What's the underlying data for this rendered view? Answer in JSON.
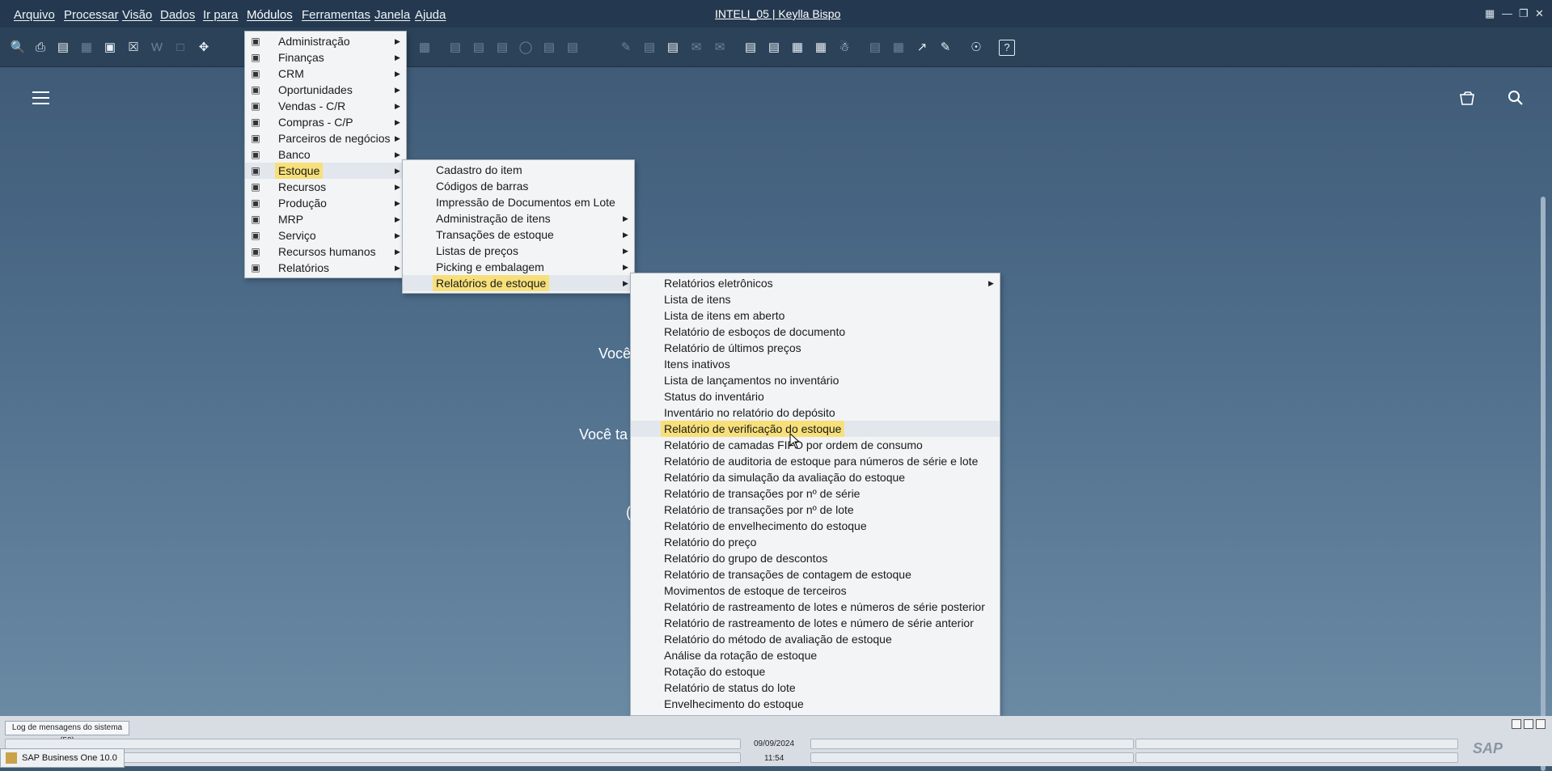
{
  "window": {
    "title": "INTELI_05 | Keylla Bispo"
  },
  "menubar": [
    {
      "label": "Arquivo"
    },
    {
      "label": "Processar"
    },
    {
      "label": "Visão"
    },
    {
      "label": "Dados"
    },
    {
      "label": "Ir para"
    },
    {
      "label": "Módulos"
    },
    {
      "label": "Ferramentas"
    },
    {
      "label": "Janela"
    },
    {
      "label": "Ajuda"
    }
  ],
  "modules_menu": [
    {
      "label": "Administração",
      "icon": "gear-icon"
    },
    {
      "label": "Finanças",
      "icon": "ledger-icon"
    },
    {
      "label": "CRM",
      "icon": "people-icon"
    },
    {
      "label": "Oportunidades",
      "icon": "chart-icon"
    },
    {
      "label": "Vendas - C/R",
      "icon": "dollar-icon"
    },
    {
      "label": "Compras - C/P",
      "icon": "cart-icon"
    },
    {
      "label": "Parceiros de negócios",
      "icon": "contacts-icon"
    },
    {
      "label": "Banco",
      "icon": "moneybag-icon"
    },
    {
      "label": "Estoque",
      "icon": "truck-icon"
    },
    {
      "label": "Recursos",
      "icon": "cube-icon"
    },
    {
      "label": "Produção",
      "icon": "box-icon"
    },
    {
      "label": "MRP",
      "icon": "calendar-icon"
    },
    {
      "label": "Serviço",
      "icon": "bank-icon"
    },
    {
      "label": "Recursos humanos",
      "icon": "person-icon"
    },
    {
      "label": "Relatórios",
      "icon": "report-icon"
    }
  ],
  "stock_menu": [
    {
      "label": "Cadastro do item"
    },
    {
      "label": "Códigos de barras"
    },
    {
      "label": "Impressão de Documentos em Lote"
    },
    {
      "label": "Administração de itens"
    },
    {
      "label": "Transações de estoque"
    },
    {
      "label": "Listas de preços"
    },
    {
      "label": "Picking e embalagem"
    },
    {
      "label": "Relatórios de estoque"
    }
  ],
  "stock_reports_menu": [
    {
      "label": "Relatórios eletrônicos"
    },
    {
      "label": "Lista de itens"
    },
    {
      "label": "Lista de itens em aberto"
    },
    {
      "label": "Relatório de esboços de documento"
    },
    {
      "label": "Relatório de últimos preços"
    },
    {
      "label": "Itens inativos"
    },
    {
      "label": "Lista de lançamentos no inventário"
    },
    {
      "label": "Status do inventário"
    },
    {
      "label": "Inventário no relatório do depósito"
    },
    {
      "label": "Relatório de verificação do estoque"
    },
    {
      "label": "Relatório de camadas FIFO por ordem de consumo"
    },
    {
      "label": "Relatório de auditoria de estoque para números de série e lote"
    },
    {
      "label": "Relatório da simulação da avaliação do estoque"
    },
    {
      "label": "Relatório de transações por nº de série"
    },
    {
      "label": "Relatório de transações por nº de lote"
    },
    {
      "label": "Relatório de envelhecimento do estoque"
    },
    {
      "label": "Relatório do preço"
    },
    {
      "label": "Relatório do grupo de descontos"
    },
    {
      "label": "Relatório de transações de contagem de estoque"
    },
    {
      "label": "Movimentos de estoque de terceiros"
    },
    {
      "label": "Relatório de rastreamento de lotes e números de série posterior"
    },
    {
      "label": "Relatório de rastreamento de lotes e número de série anterior"
    },
    {
      "label": "Relatório do método de avaliação de estoque"
    },
    {
      "label": "Análise da rotação de estoque"
    },
    {
      "label": "Rotação do estoque"
    },
    {
      "label": "Relatório de status do lote"
    },
    {
      "label": "Envelhecimento do estoque"
    }
  ],
  "background": {
    "line1": "Você",
    "line2": "Você ta",
    "line3": "("
  },
  "statusbar": {
    "log_tab": "Log de mensagens do sistema (50)",
    "date": "09/09/2024",
    "time": "11:54",
    "taskbar_app": "SAP Business One 10.0",
    "logo": "SAP"
  },
  "colors": {
    "highlight": "#f7e07a",
    "menubar": "#24394f",
    "background": "#3d5873"
  }
}
